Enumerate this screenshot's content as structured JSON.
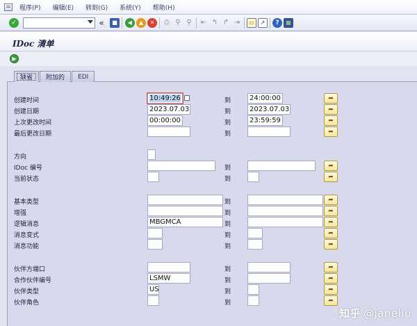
{
  "menu": {
    "items": [
      "程序(P)",
      "编辑(E)",
      "转到(G)",
      "系统(Y)",
      "帮助(H)"
    ]
  },
  "toolbar": {
    "command_value": "",
    "back_glyph": "«",
    "icons": [
      "check-icon",
      "save-icon",
      "back-icon",
      "exit-icon",
      "cancel-icon",
      "print-icon",
      "find-icon",
      "find-next-icon",
      "first-page-icon",
      "prev-page-icon",
      "next-page-icon",
      "last-page-icon",
      "new-session-icon",
      "shortcut-icon",
      "help-icon",
      "layout-icon"
    ]
  },
  "title": "IDoc 清单",
  "tabs": [
    {
      "label": "缺省",
      "active": true
    },
    {
      "label": "附加的",
      "active": false
    },
    {
      "label": "EDI",
      "active": false
    }
  ],
  "form": {
    "to_label": "到",
    "created_time": {
      "label": "创建时间",
      "from": "10:49:26",
      "to": "24:00:00"
    },
    "created_date": {
      "label": "创建日期",
      "from": "2023.07.03",
      "to": "2023.07.03"
    },
    "last_change_time": {
      "label": "上次更改时间",
      "from": "00:00:00",
      "to": "23:59:59"
    },
    "last_change_date": {
      "label": "最后更改日期",
      "from": "",
      "to": ""
    },
    "direction": {
      "label": "方向",
      "value": ""
    },
    "idoc_number": {
      "label": "IDoc 编号",
      "from": "",
      "to": ""
    },
    "current_status": {
      "label": "当前状态",
      "from": "",
      "to": ""
    },
    "basic_type": {
      "label": "基本类型",
      "from": "",
      "to": ""
    },
    "enhancement": {
      "label": "增强",
      "from": "",
      "to": ""
    },
    "logical_message": {
      "label": "逻辑消息",
      "from": "MBGMCA",
      "to": ""
    },
    "message_variant": {
      "label": "消息变式",
      "from": "",
      "to": ""
    },
    "message_function": {
      "label": "消息功能",
      "from": "",
      "to": ""
    },
    "partner_port": {
      "label": "伙伴方端口",
      "from": "",
      "to": ""
    },
    "partner_number": {
      "label": "合作伙伴编号",
      "from": "LSMW",
      "to": ""
    },
    "partner_type": {
      "label": "伙伴类型",
      "from": "US",
      "to": ""
    },
    "partner_role": {
      "label": "伙伴角色",
      "from": "",
      "to": ""
    }
  },
  "watermark": {
    "logo": "知乎",
    "handle": "@janeliu"
  },
  "colors": {
    "background": "#e1e3f0",
    "panel": "#d8d9ec",
    "more_button": "#f6e59c",
    "accent_green": "#39a83a"
  }
}
